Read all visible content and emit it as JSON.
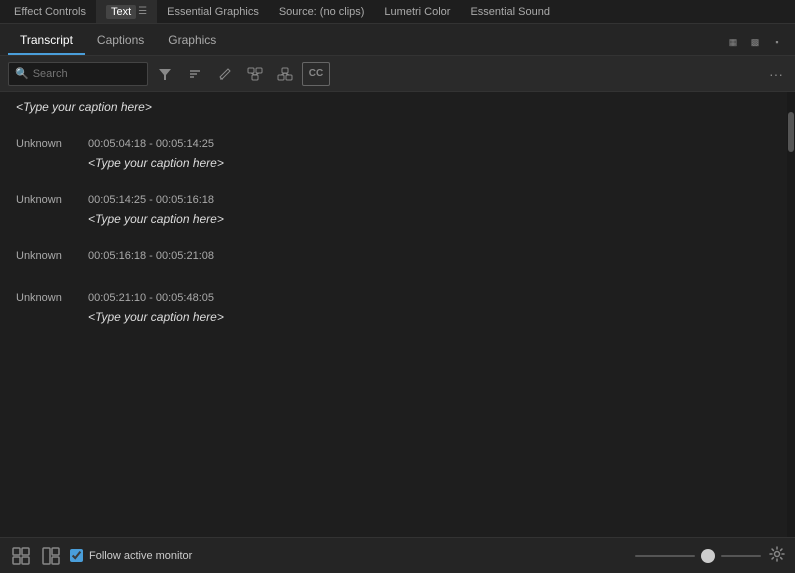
{
  "topTabs": [
    {
      "id": "effect-controls",
      "label": "Effect Controls",
      "active": false
    },
    {
      "id": "text",
      "label": "Text",
      "pill": true,
      "active": true
    },
    {
      "id": "essential-graphics",
      "label": "Essential Graphics",
      "active": false
    },
    {
      "id": "source",
      "label": "Source: (no clips)",
      "active": false
    },
    {
      "id": "lumetri-color",
      "label": "Lumetri Color",
      "active": false
    },
    {
      "id": "essential-sound",
      "label": "Essential Sound",
      "active": false
    }
  ],
  "secondaryTabs": [
    {
      "id": "transcript",
      "label": "Transcript",
      "active": true
    },
    {
      "id": "captions",
      "label": "Captions",
      "active": false
    },
    {
      "id": "graphics",
      "label": "Graphics",
      "active": false
    }
  ],
  "toolbar": {
    "searchPlaceholder": "Search",
    "moreLabel": "···"
  },
  "transcriptEntries": [
    {
      "id": 1,
      "speaker": "",
      "timeRange": "",
      "caption": "<Type your caption here>"
    },
    {
      "id": 2,
      "speaker": "Unknown",
      "timeRange": "00:05:04:18 - 00:05:14:25",
      "caption": "<Type your caption here>"
    },
    {
      "id": 3,
      "speaker": "Unknown",
      "timeRange": "00:05:14:25 - 00:05:16:18",
      "caption": "<Type your caption here>"
    },
    {
      "id": 4,
      "speaker": "Unknown",
      "timeRange": "00:05:16:18 - 00:05:21:08",
      "caption": ""
    },
    {
      "id": 5,
      "speaker": "Unknown",
      "timeRange": "00:05:21:10 - 00:05:48:05",
      "caption": "<Type your caption here>"
    }
  ],
  "bottomBar": {
    "followActiveMonitor": "Follow active monitor",
    "followChecked": true
  },
  "colors": {
    "activeTab": "#4a9eda",
    "background": "#1e1e1e",
    "toolbar": "#2a2a2a"
  }
}
